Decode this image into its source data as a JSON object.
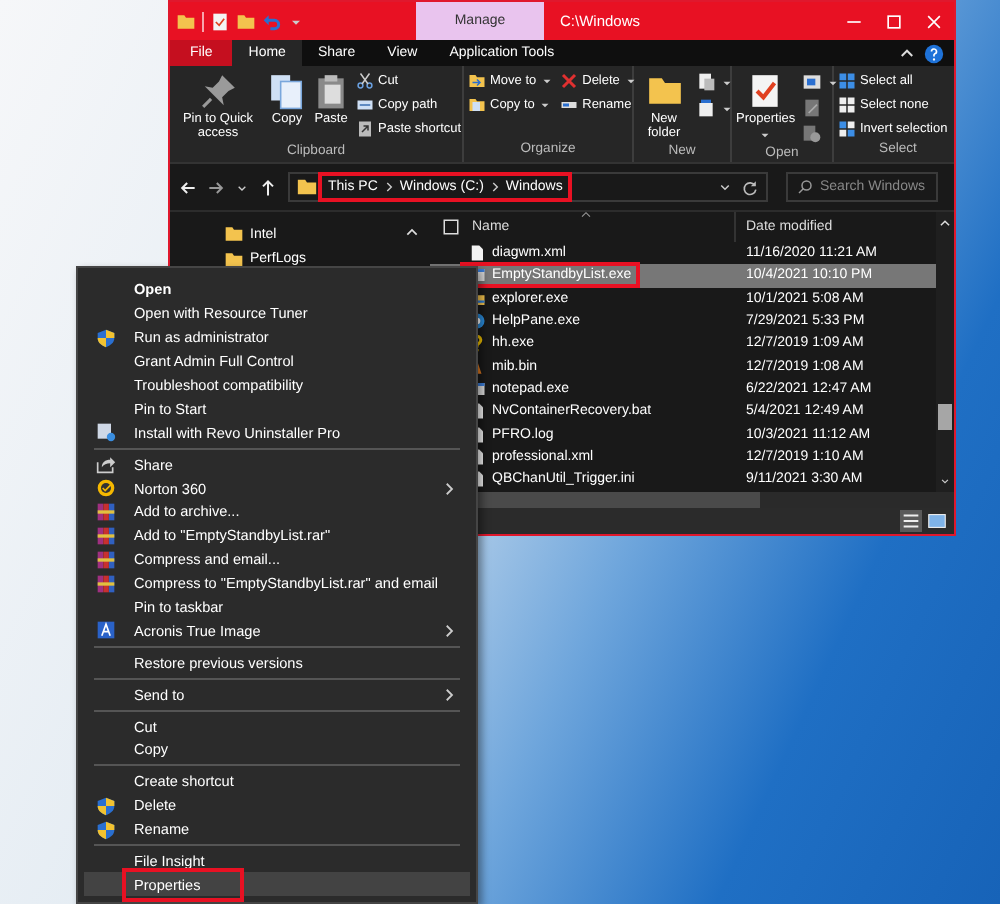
{
  "window": {
    "title": "C:\\Windows",
    "context_tab": "Manage"
  },
  "ribbon": {
    "tabs": [
      {
        "label": "File",
        "kind": "file",
        "selected": false
      },
      {
        "label": "Home",
        "kind": "tab",
        "selected": true
      },
      {
        "label": "Share",
        "kind": "tab",
        "selected": false
      },
      {
        "label": "View",
        "kind": "tab",
        "selected": false
      },
      {
        "label": "Application Tools",
        "kind": "tab",
        "selected": false
      }
    ],
    "groups": [
      {
        "label": "Clipboard",
        "columns": [
          [
            {
              "label": "Pin to Quick access",
              "kind": "large",
              "has_menu": false
            }
          ],
          [
            {
              "label": "Copy",
              "kind": "large",
              "has_menu": false
            }
          ],
          [
            {
              "label": "Paste",
              "kind": "large",
              "has_menu": false
            }
          ],
          [
            {
              "label": "Cut",
              "kind": "small",
              "has_menu": false
            },
            {
              "label": "Copy path",
              "kind": "small",
              "has_menu": false
            },
            {
              "label": "Paste shortcut",
              "kind": "small",
              "has_menu": false
            }
          ]
        ]
      },
      {
        "label": "Organize",
        "columns": [
          [
            {
              "label": "Move to",
              "kind": "small",
              "has_menu": true
            },
            {
              "label": "Copy to",
              "kind": "small",
              "has_menu": true
            }
          ],
          [
            {
              "label": "Delete",
              "kind": "small",
              "has_menu": true
            },
            {
              "label": "Rename",
              "kind": "small",
              "has_menu": false
            }
          ]
        ]
      },
      {
        "label": "New",
        "columns": [
          [
            {
              "label": "New folder",
              "kind": "large",
              "has_menu": false
            }
          ],
          [
            {
              "kind": "icon",
              "has_menu": true
            },
            {
              "kind": "icon",
              "has_menu": true
            }
          ]
        ]
      },
      {
        "label": "Open",
        "columns": [
          [
            {
              "label": "Properties",
              "kind": "large",
              "has_menu": true
            }
          ],
          [
            {
              "kind": "icon",
              "has_menu": true
            },
            {
              "kind": "icon",
              "has_menu": false
            },
            {
              "kind": "icon",
              "has_menu": false
            }
          ]
        ]
      },
      {
        "label": "Select",
        "columns": [
          [
            {
              "label": "Select all",
              "kind": "small",
              "has_menu": false
            },
            {
              "label": "Select none",
              "kind": "small",
              "has_menu": false
            },
            {
              "label": "Invert selection",
              "kind": "small",
              "has_menu": false
            }
          ]
        ]
      }
    ]
  },
  "address": {
    "path": [
      "This PC",
      "Windows (C:)",
      "Windows"
    ],
    "outlined": true,
    "search_placeholder": "Search Windows"
  },
  "navigation": {
    "items": [
      "Intel",
      "PerfLogs"
    ]
  },
  "file_list": {
    "columns": [
      "Name",
      "Date modified"
    ],
    "rows": [
      {
        "name": "diagwm.xml",
        "date_modified": "11/16/2020 11:21 AM",
        "selected": false,
        "outlined": false
      },
      {
        "name": "EmptyStandbyList.exe",
        "date_modified": "10/4/2021 10:10 PM",
        "selected": true,
        "outlined": true
      },
      {
        "name": "explorer.exe",
        "date_modified": "10/1/2021 5:08 AM",
        "selected": false,
        "outlined": false
      },
      {
        "name": "HelpPane.exe",
        "date_modified": "7/29/2021 5:33 PM",
        "selected": false,
        "outlined": false
      },
      {
        "name": "hh.exe",
        "date_modified": "12/7/2019 1:09 AM",
        "selected": false,
        "outlined": false
      },
      {
        "name": "mib.bin",
        "date_modified": "12/7/2019 1:08 AM",
        "selected": false,
        "outlined": false
      },
      {
        "name": "notepad.exe",
        "date_modified": "6/22/2021 12:47 AM",
        "selected": false,
        "outlined": false
      },
      {
        "name": "NvContainerRecovery.bat",
        "date_modified": "5/4/2021 12:49 AM",
        "selected": false,
        "outlined": false
      },
      {
        "name": "PFRO.log",
        "date_modified": "10/3/2021 11:12 AM",
        "selected": false,
        "outlined": false
      },
      {
        "name": "professional.xml",
        "date_modified": "12/7/2019 1:10 AM",
        "selected": false,
        "outlined": false
      },
      {
        "name": "QBChanUtil_Trigger.ini",
        "date_modified": "9/11/2021 3:30 AM",
        "selected": false,
        "outlined": false
      }
    ]
  },
  "context_menu": {
    "items": [
      {
        "kind": "item",
        "label": "Open",
        "default": true,
        "selected": false
      },
      {
        "kind": "item",
        "label": "Open with Resource Tuner",
        "selected": false
      },
      {
        "kind": "item",
        "label": "Run as administrator",
        "selected": false
      },
      {
        "kind": "item",
        "label": "Grant Admin Full Control",
        "selected": false
      },
      {
        "kind": "item",
        "label": "Troubleshoot compatibility",
        "selected": false
      },
      {
        "kind": "item",
        "label": "Pin to Start",
        "selected": false
      },
      {
        "kind": "item",
        "label": "Install with Revo Uninstaller Pro",
        "selected": false
      },
      {
        "kind": "separator"
      },
      {
        "kind": "item",
        "label": "Share",
        "selected": false
      },
      {
        "kind": "item",
        "label": "Norton 360",
        "submenu": true,
        "selected": false
      },
      {
        "kind": "item",
        "label": "Add to archive...",
        "selected": false
      },
      {
        "kind": "item",
        "label": "Add to \"EmptyStandbyList.rar\"",
        "selected": false
      },
      {
        "kind": "item",
        "label": "Compress and email...",
        "selected": false
      },
      {
        "kind": "item",
        "label": "Compress to \"EmptyStandbyList.rar\" and email",
        "selected": false
      },
      {
        "kind": "item",
        "label": "Pin to taskbar",
        "selected": false
      },
      {
        "kind": "item",
        "label": "Acronis True Image",
        "submenu": true,
        "selected": false
      },
      {
        "kind": "separator"
      },
      {
        "kind": "item",
        "label": "Restore previous versions",
        "selected": false
      },
      {
        "kind": "separator"
      },
      {
        "kind": "item",
        "label": "Send to",
        "submenu": true,
        "selected": false
      },
      {
        "kind": "separator"
      },
      {
        "kind": "item",
        "label": "Cut",
        "selected": false
      },
      {
        "kind": "item",
        "label": "Copy",
        "selected": false
      },
      {
        "kind": "separator"
      },
      {
        "kind": "item",
        "label": "Create shortcut",
        "selected": false
      },
      {
        "kind": "item",
        "label": "Delete",
        "selected": false
      },
      {
        "kind": "item",
        "label": "Rename",
        "selected": false
      },
      {
        "kind": "separator"
      },
      {
        "kind": "item",
        "label": "File Insight",
        "selected": false
      },
      {
        "kind": "item",
        "label": "Properties",
        "selected": true,
        "outlined": true
      }
    ]
  }
}
